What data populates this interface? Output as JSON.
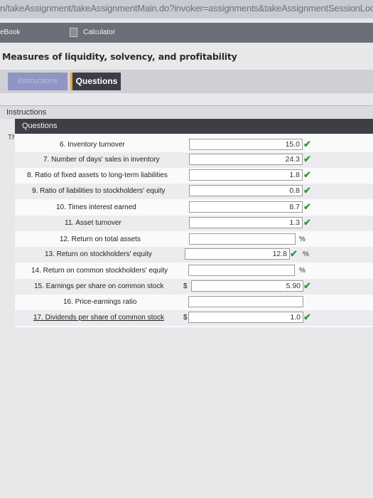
{
  "browser": {
    "url": "n/takeAssignment/takeAssignmentMain.do?invoker=assignments&takeAssignmentSessionLocato"
  },
  "toolbar": {
    "ebook_label": "eBook",
    "calculator_label": "Calculator"
  },
  "page": {
    "title": "Measures of liquidity, solvency, and profitability"
  },
  "tabs": {
    "instructions": "Instructions",
    "questions": "Questions"
  },
  "sections": {
    "instructions_header": "Instructions",
    "questions_header": "Questions",
    "truncated_text": "Th"
  },
  "rows": [
    {
      "label": "6. Inventory turnover",
      "value": "15.0",
      "check": true,
      "unit": ""
    },
    {
      "label": "7. Number of days' sales in inventory",
      "value": "24.3",
      "check": true,
      "unit": ""
    },
    {
      "label": "8. Ratio of fixed assets to long-term liabilities",
      "value": "1.8",
      "check": true,
      "unit": ""
    },
    {
      "label": "9. Ratio of liabilities to stockholders' equity",
      "value": "0.8",
      "check": true,
      "unit": ""
    },
    {
      "label": "10. Times interest earned",
      "value": "8.7",
      "check": true,
      "unit": ""
    },
    {
      "label": "11. Asset turnover",
      "value": "1.3",
      "check": true,
      "unit": ""
    },
    {
      "label": "12. Return on total assets",
      "value": "",
      "check": false,
      "unit": "%"
    },
    {
      "label": "13. Return on stockholders' equity",
      "value": "12.8",
      "check": true,
      "unit": "%"
    },
    {
      "label": "14. Return on common stockholders' equity",
      "value": "",
      "check": false,
      "unit": "%"
    },
    {
      "label": "15. Earnings per share on common stock",
      "value": "5.90",
      "check": true,
      "unit": "",
      "prefix": "$"
    },
    {
      "label": "16. Price-earnings ratio",
      "value": "",
      "check": false,
      "unit": ""
    },
    {
      "label": "17. Dividends per share of common stock",
      "value": "1.0",
      "check": true,
      "unit": "",
      "prefix": "$"
    }
  ],
  "icons": {
    "check": "check-icon",
    "calculator": "calculator-icon"
  },
  "colors": {
    "check": "#2a9a3a",
    "toolbar": "#6d6f78",
    "active_tab": "#3c3d46",
    "inactive_tab": "#8f96c4"
  }
}
